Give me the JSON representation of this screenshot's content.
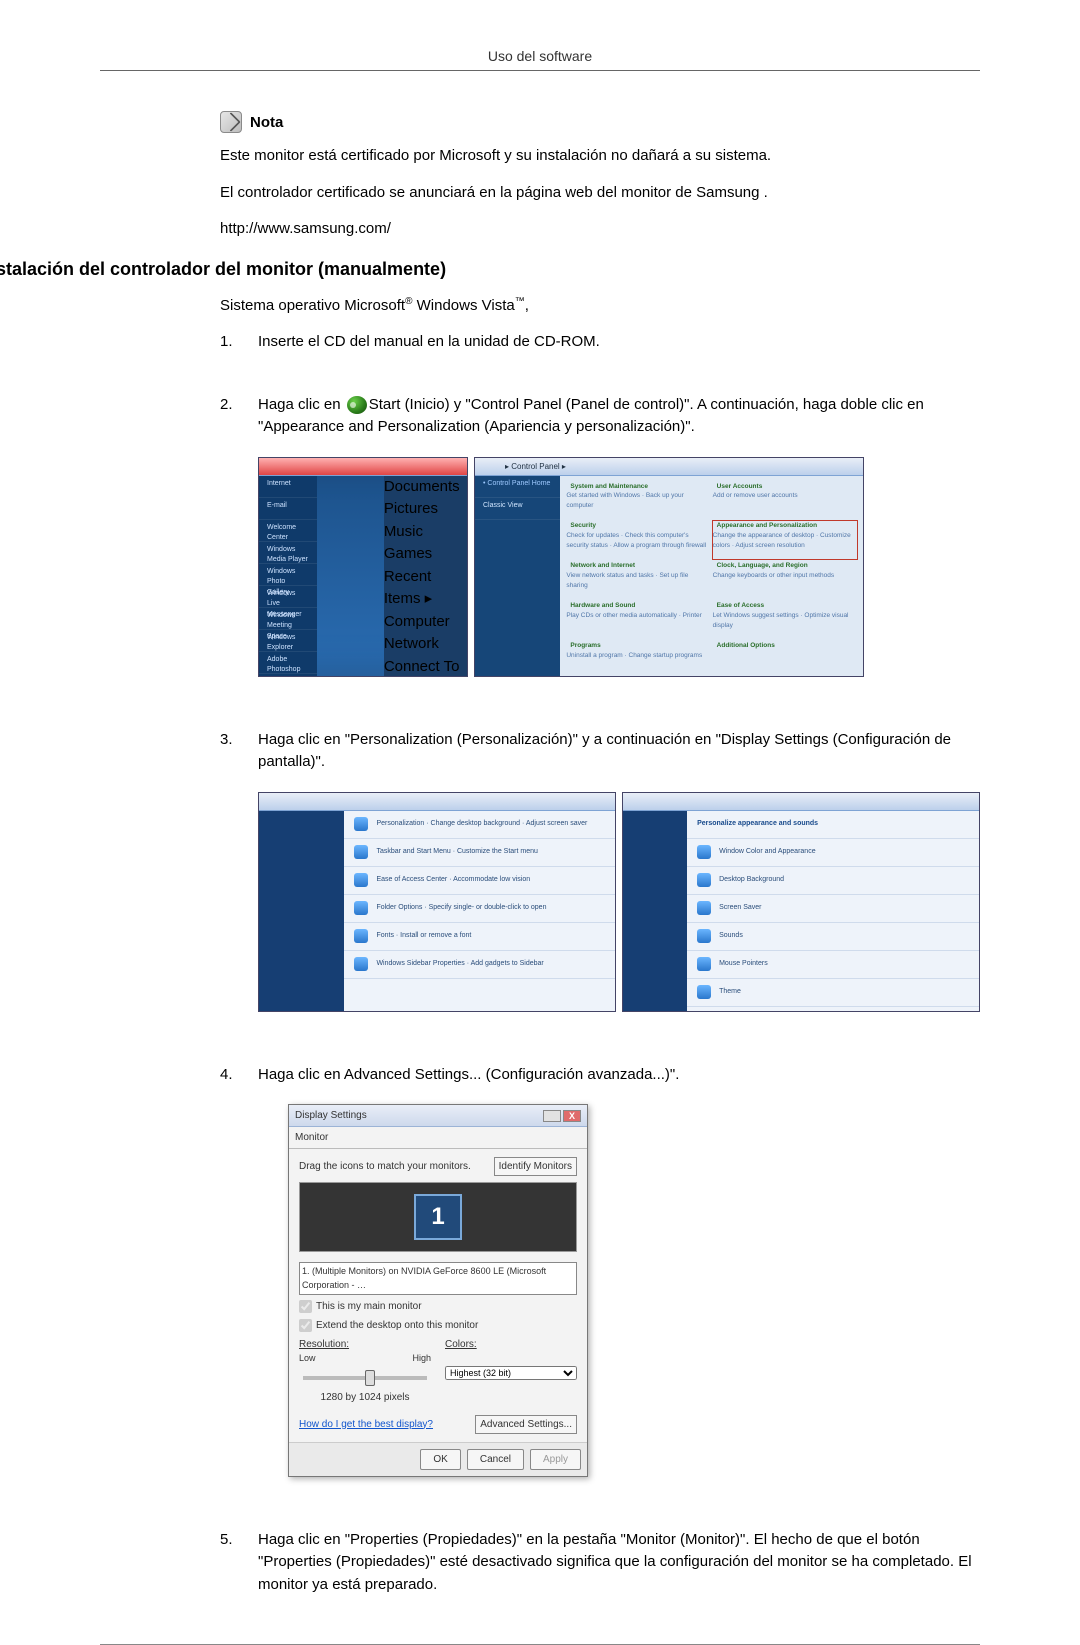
{
  "header": {
    "title": "Uso del software"
  },
  "note": {
    "label": "Nota"
  },
  "paragraphs": {
    "p1": "Este monitor está certificado por Microsoft y su instalación no dañará a su sistema.",
    "p2": "El controlador certificado se anunciará en la página web del monitor de Samsung .",
    "p3": "http://www.samsung.com/"
  },
  "h2": "Instalación del controlador del monitor (manualmente)",
  "intro": {
    "prefix": "Sistema operativo Microsoft",
    "reg": "®",
    "mid": " Windows Vista",
    "tm": "™",
    "suffix": ","
  },
  "steps": {
    "s1": "Inserte el CD del manual en la unidad de CD-ROM.",
    "s2a": "Haga clic en ",
    "s2b": "Start (Inicio) y \"Control Panel (Panel de control)\". A continuación, haga doble clic en \"Appearance and Personalization (Apariencia y personalización)\".",
    "s3": "Haga clic en \"Personalization (Personalización)\" y a continuación en \"Display Settings (Configuración de pantalla)\".",
    "s4": "Haga clic en Advanced Settings... (Configuración avanzada...)\".",
    "s5": "Haga clic en \"Properties (Propiedades)\" en la pestaña \"Monitor (Monitor)\". El hecho de que el botón \"Properties (Propiedades)\" esté desactivado significa que la configuración del monitor se ha completado. El monitor ya está preparado."
  },
  "nums": {
    "n1": "1",
    "n2": "2",
    "n3": "3",
    "n4": "4",
    "n5": "5"
  },
  "cp_shot": {
    "breadcrumb": "▸ Control Panel ▸",
    "cat1": "System and Maintenance",
    "cat1s": "Get started with Windows · Back up your computer",
    "cat2": "Security",
    "cat2s": "Check for updates · Check this computer's security status · Allow a program through firewall",
    "cat3": "Network and Internet",
    "cat3s": "View network status and tasks · Set up file sharing",
    "cat4": "Hardware and Sound",
    "cat4s": "Play CDs or other media automatically · Printer",
    "cat5": "Programs",
    "cat5s": "Uninstall a program · Change startup programs",
    "cat6": "User Accounts",
    "cat6s": "Add or remove user accounts",
    "cat7": "Appearance and Personalization",
    "cat7s": "Change the appearance of desktop · Customize colors · Adjust screen resolution",
    "cat8": "Clock, Language, and Region",
    "cat8s": "Change keyboards or other input methods",
    "cat9": "Ease of Access",
    "cat9s": "Let Windows suggest settings · Optimize visual display",
    "cat10": "Additional Options"
  },
  "ds": {
    "title": "Display Settings",
    "tab": "Monitor",
    "drag_label": "Drag the icons to match your monitors.",
    "identify": "Identify Monitors",
    "mon_num": "1",
    "select": "1. (Multiple Monitors) on NVIDIA GeForce 8600 LE (Microsoft Corporation - …",
    "chk1": "This is my main monitor",
    "chk2": "Extend the desktop onto this monitor",
    "res_label": "Resolution:",
    "low": "Low",
    "high": "High",
    "res_val": "1280 by 1024 pixels",
    "col_label": "Colors:",
    "col_val": "Highest (32 bit)",
    "help": "How do I get the best display?",
    "adv": "Advanced Settings...",
    "ok": "OK",
    "cancel": "Cancel",
    "apply": "Apply"
  }
}
